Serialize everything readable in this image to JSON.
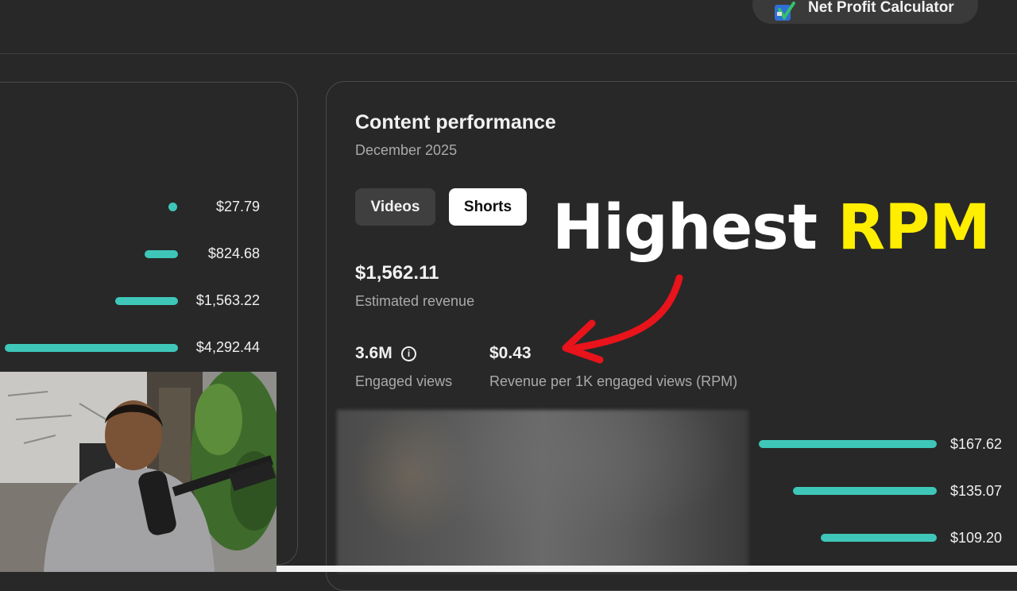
{
  "header": {
    "net_profit_label": "Net Profit Calculator",
    "icon": "calculator-logo-icon"
  },
  "left_card": {
    "rows": [
      {
        "value": "$27.79",
        "fraction": 0.006
      },
      {
        "value": "$824.68",
        "fraction": 0.19
      },
      {
        "value": "$1,563.22",
        "fraction": 0.36
      },
      {
        "value": "$4,292.44",
        "fraction": 1.0
      }
    ]
  },
  "content": {
    "title": "Content performance",
    "period": "December 2025",
    "tabs": [
      {
        "label": "Videos",
        "selected": false
      },
      {
        "label": "Shorts",
        "selected": true
      }
    ],
    "revenue": {
      "value": "$1,562.11",
      "label": "Estimated revenue"
    },
    "engaged_views": {
      "value": "3.6M",
      "label": "Engaged views",
      "icon": "info-icon"
    },
    "rpm": {
      "value": "$0.43",
      "label": "Revenue per 1K engaged views (RPM)"
    }
  },
  "right_bars": [
    {
      "value": "$167.62",
      "fraction": 1.0
    },
    {
      "value": "$135.07",
      "fraction": 0.81
    },
    {
      "value": "$109.20",
      "fraction": 0.65
    }
  ],
  "overlay": {
    "text_main": "Highest",
    "text_highlight": "RPM",
    "highlight_color": "#ffee00",
    "arrow_color": "#e8131b"
  },
  "colors": {
    "background": "#282828",
    "bar": "#3ec7b9",
    "muted_text": "#aaaaaa"
  }
}
